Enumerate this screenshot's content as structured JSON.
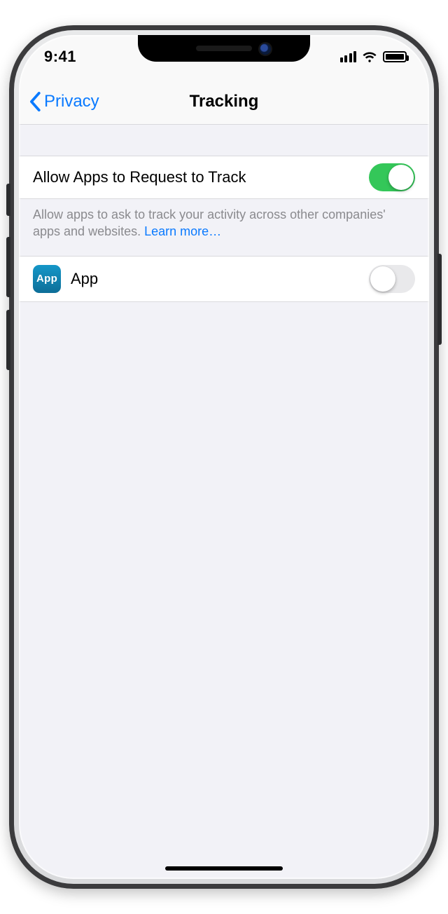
{
  "status": {
    "time": "9:41"
  },
  "nav": {
    "back_label": "Privacy",
    "title": "Tracking"
  },
  "settings": {
    "allow_label": "Allow Apps to Request to Track",
    "allow_on": true,
    "footer_text": "Allow apps to ask to track your activity across other companies' apps and websites. ",
    "learn_more": "Learn more…"
  },
  "apps": [
    {
      "icon_label": "App",
      "name": "App",
      "tracking_on": false
    }
  ],
  "colors": {
    "link": "#0a7aff",
    "switch_on": "#34c759",
    "app_icon": "#0d7aa5"
  }
}
